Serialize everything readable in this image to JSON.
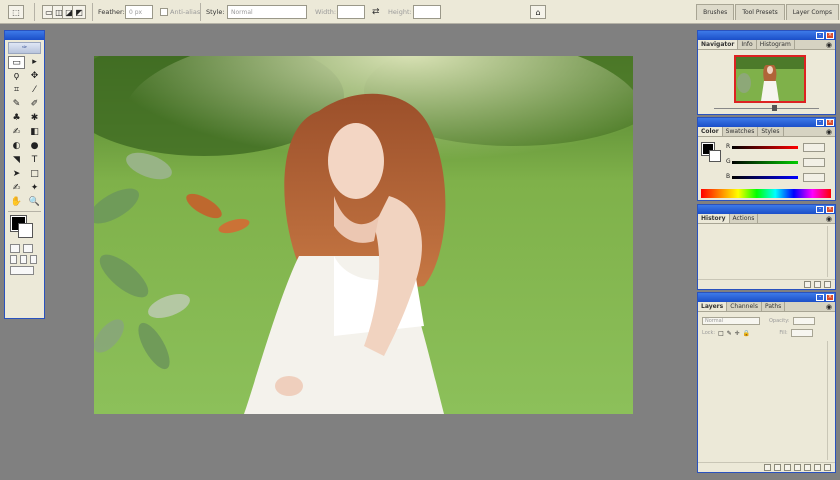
{
  "options_bar": {
    "feather_label": "Feather:",
    "feather_value": "0 px",
    "antialias_label": "Anti-alias",
    "style_label": "Style:",
    "style_value": "Normal",
    "width_label": "Width:",
    "height_label": "Height:",
    "swap_icon": "⇄",
    "palette_tabs": [
      "Brushes",
      "Tool Presets",
      "Layer Comps"
    ]
  },
  "toolbox": {
    "logo_icon": "feather-icon",
    "tools": [
      "▭",
      "▸",
      "ϙ",
      "✥",
      "⌗",
      "⁄",
      "✎",
      "✐",
      "♣",
      "✱",
      "✍",
      "◧",
      "◐",
      "●",
      "◥",
      "T",
      "➤",
      "□",
      "✍",
      "✦",
      "✋",
      "🔍"
    ]
  },
  "panels": {
    "navigator": {
      "tabs": [
        "Navigator",
        "Info",
        "Histogram"
      ]
    },
    "color": {
      "tabs": [
        "Color",
        "Swatches",
        "Styles"
      ],
      "channels": [
        "R",
        "G",
        "B"
      ],
      "foreground": "#000000",
      "background": "#ffffff"
    },
    "history": {
      "tabs": [
        "History",
        "Actions"
      ]
    },
    "layers": {
      "tabs": [
        "Layers",
        "Channels",
        "Paths"
      ],
      "blend_mode": "Normal",
      "opacity_label": "Opacity:",
      "lock_label": "Lock:",
      "fill_label": "Fill:"
    }
  },
  "colors": {
    "accent": "#2a52be",
    "chrome": "#ece9d8",
    "workspace": "#808080"
  }
}
